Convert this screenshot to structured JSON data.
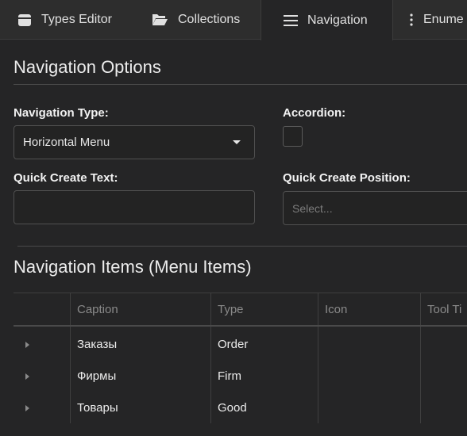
{
  "tabs": [
    {
      "label": "Types Editor",
      "icon": "database-icon"
    },
    {
      "label": "Collections",
      "icon": "folder-open-icon"
    },
    {
      "label": "Navigation",
      "icon": "menu-lines-icon",
      "active": true
    },
    {
      "label": "Enume",
      "icon": "kebab-menu-icon"
    }
  ],
  "options": {
    "title": "Navigation Options",
    "nav_type_label": "Navigation Type:",
    "nav_type_value": "Horizontal Menu",
    "accordion_label": "Accordion:",
    "accordion_checked": false,
    "quick_create_text_label": "Quick Create Text:",
    "quick_create_text_value": "",
    "quick_create_position_label": "Quick Create Position:",
    "quick_create_position_placeholder": "Select..."
  },
  "items": {
    "title": "Navigation Items (Menu Items)",
    "columns": [
      "Caption",
      "Type",
      "Icon",
      "Tool Ti"
    ],
    "rows": [
      {
        "caption": "Заказы",
        "type": "Order"
      },
      {
        "caption": "Фирмы",
        "type": "Firm"
      },
      {
        "caption": "Товары",
        "type": "Good"
      }
    ]
  }
}
